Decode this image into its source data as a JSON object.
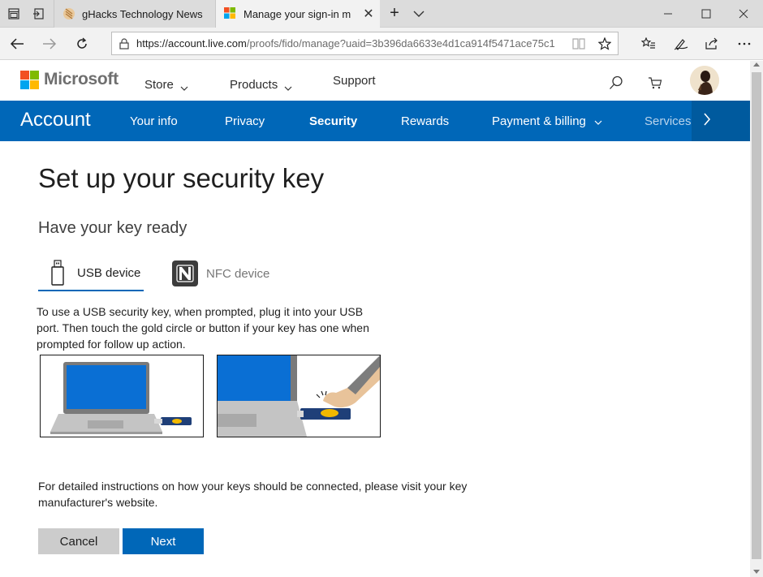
{
  "browser": {
    "tabs": [
      {
        "title": "gHacks Technology News",
        "active": false
      },
      {
        "title": "Manage your sign-in m",
        "active": true
      }
    ],
    "address": {
      "url_host": "https://account.live.com",
      "url_path": "/proofs/fido/manage?uaid=3b396da6633e4d1ca914f5471ace75c1"
    }
  },
  "header": {
    "brand": "Microsoft",
    "nav": [
      "Store",
      "Products",
      "Support"
    ]
  },
  "account_nav": {
    "title": "Account",
    "items": [
      "Your info",
      "Privacy",
      "Security",
      "Rewards",
      "Payment & billing",
      "Services"
    ],
    "active": "Security"
  },
  "content": {
    "title": "Set up your security key",
    "subtitle": "Have your key ready",
    "tabs": {
      "usb": "USB device",
      "nfc": "NFC device"
    },
    "description": "To use a USB security key, when prompted, plug it into your USB port. Then touch the gold circle or button if your key has one when prompted for follow up action.",
    "detail": "For detailed instructions on how your keys should be connected, please visit your key manufacturer's website.",
    "buttons": {
      "cancel": "Cancel",
      "next": "Next"
    }
  },
  "colors": {
    "accent": "#0067b8",
    "accent_dark": "#005a9e",
    "ms_red": "#f25022",
    "ms_green": "#7fba00",
    "ms_blue": "#00a4ef",
    "ms_yellow": "#ffb900"
  }
}
